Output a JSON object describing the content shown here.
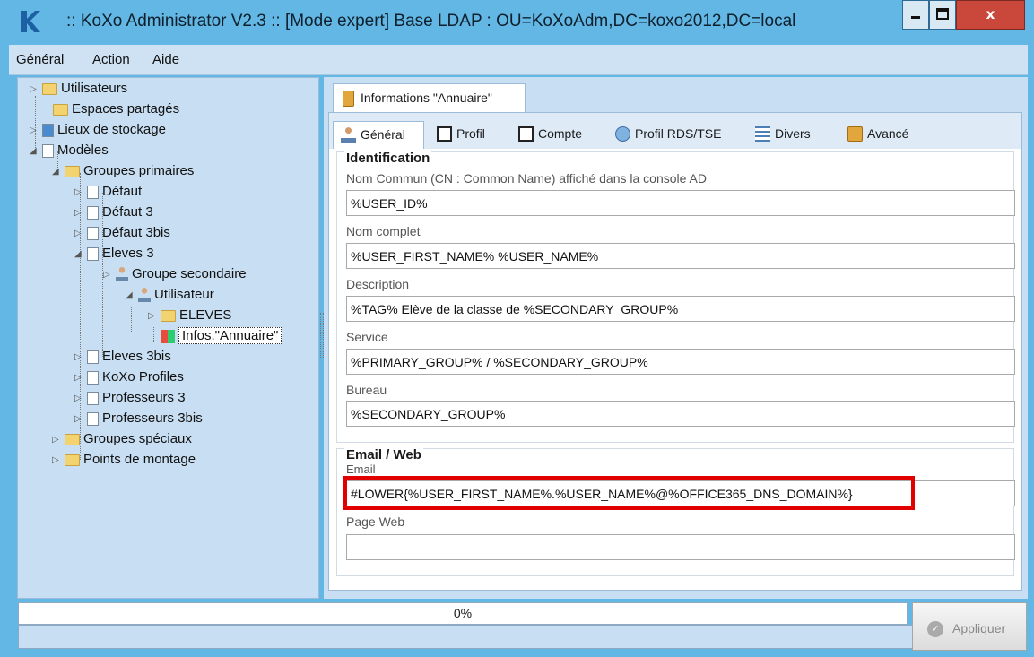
{
  "window": {
    "title": ":: KoXo Administrator V2.3 :: [Mode expert] Base LDAP : OU=KoXoAdm,DC=koxo2012,DC=local",
    "close_glyph": "x"
  },
  "menu": [
    {
      "label": "Général"
    },
    {
      "label": "Action"
    },
    {
      "label": "Aide"
    }
  ],
  "tree": [
    {
      "label": "Utilisateurs"
    },
    {
      "label": "Espaces partagés"
    },
    {
      "label": "Lieux de stockage"
    },
    {
      "label": "Modèles"
    },
    {
      "label": "Groupes primaires"
    },
    {
      "label": "Défaut"
    },
    {
      "label": "Défaut 3"
    },
    {
      "label": "Défaut 3bis"
    },
    {
      "label": "Eleves 3"
    },
    {
      "label": "Groupe secondaire"
    },
    {
      "label": "Utilisateur"
    },
    {
      "label": "ELEVES"
    },
    {
      "label": "Infos.\"Annuaire\""
    },
    {
      "label": "Eleves 3bis"
    },
    {
      "label": "KoXo Profiles"
    },
    {
      "label": "Professeurs 3"
    },
    {
      "label": "Professeurs 3bis"
    },
    {
      "label": "Groupes spéciaux"
    },
    {
      "label": "Points de montage"
    }
  ],
  "outer_tab": {
    "label": "Informations \"Annuaire\""
  },
  "inner_tabs": [
    {
      "label": "Général"
    },
    {
      "label": "Profil"
    },
    {
      "label": "Compte"
    },
    {
      "label": "Profil RDS/TSE"
    },
    {
      "label": "Divers"
    },
    {
      "label": "Avancé"
    }
  ],
  "identification": {
    "title": "Identification",
    "fields": [
      {
        "label": "Nom Commun (CN : Common Name) affiché dans la console AD",
        "value": "%USER_ID%"
      },
      {
        "label": "Nom complet",
        "value": "%USER_FIRST_NAME% %USER_NAME%"
      },
      {
        "label": "Description",
        "value": "%TAG% Elève de la classe de %SECONDARY_GROUP%"
      },
      {
        "label": "Service",
        "value": "%PRIMARY_GROUP% / %SECONDARY_GROUP%"
      },
      {
        "label": "Bureau",
        "value": "%SECONDARY_GROUP%"
      }
    ]
  },
  "email_web": {
    "title": "Email / Web",
    "fields": [
      {
        "label": "Email",
        "value": "#LOWER{%USER_FIRST_NAME%.%USER_NAME%@%OFFICE365_DNS_DOMAIN%}"
      },
      {
        "label": "Page Web",
        "value": ""
      }
    ]
  },
  "progress": {
    "text": "0%",
    "value": 0
  },
  "apply_button": {
    "label": "Appliquer",
    "enabled": false
  },
  "colors": {
    "highlight": "#e10000",
    "window": "#62b7e4",
    "panel": "#c8def2"
  }
}
